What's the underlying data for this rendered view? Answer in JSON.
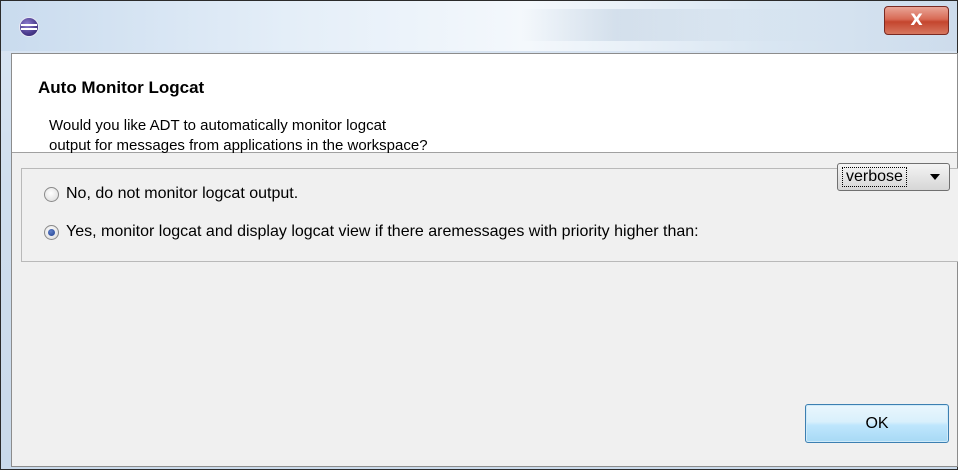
{
  "window": {
    "close_glyph": "X"
  },
  "header": {
    "title": "Auto Monitor Logcat",
    "message_lines": [
      "Would you like ADT to automatically monitor logcat",
      "output for messages from applications in the workspace?"
    ]
  },
  "options": {
    "no": {
      "label": "No, do not monitor logcat output.",
      "selected": false
    },
    "yes": {
      "label": "Yes, monitor logcat and display logcat view if there aremessages with priority higher than:",
      "selected": true
    }
  },
  "priority_select": {
    "value": "verbose"
  },
  "buttons": {
    "ok": "OK"
  },
  "colors": {
    "close_button": "#d05a43",
    "ok_button_border": "#3c7fb1",
    "radio_selected": "#1f3f8f"
  },
  "icons": [
    "eclipse-app-icon",
    "close-icon",
    "radio-unchecked",
    "radio-checked",
    "dropdown-arrow-icon"
  ]
}
